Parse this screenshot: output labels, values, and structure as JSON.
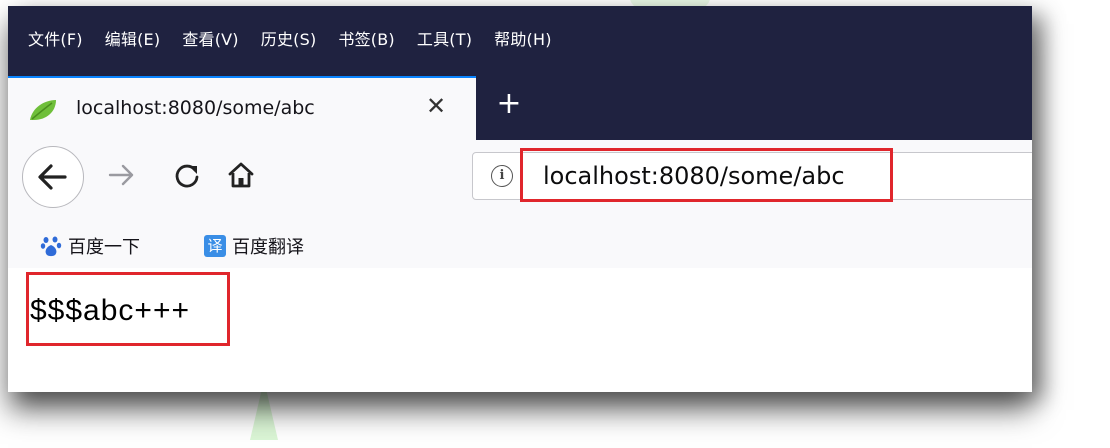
{
  "menu": {
    "items": [
      "文件(F)",
      "编辑(E)",
      "查看(V)",
      "历史(S)",
      "书签(B)",
      "工具(T)",
      "帮助(H)"
    ]
  },
  "tab": {
    "title": "localhost:8080/some/abc",
    "close_glyph": "✕",
    "new_tab_glyph": "+"
  },
  "toolbar": {
    "url": "localhost:8080/some/abc",
    "info_glyph": "i"
  },
  "bookmarks": [
    {
      "label": "百度一下",
      "icon": "baidu-paw-icon"
    },
    {
      "label": "百度翻译",
      "icon": "translate-icon",
      "icon_text": "译"
    }
  ],
  "page": {
    "text": "$$$abc+++"
  },
  "colors": {
    "menubar": "#1f2240",
    "highlight": "#e0262c",
    "accent": "#0a84ff"
  }
}
